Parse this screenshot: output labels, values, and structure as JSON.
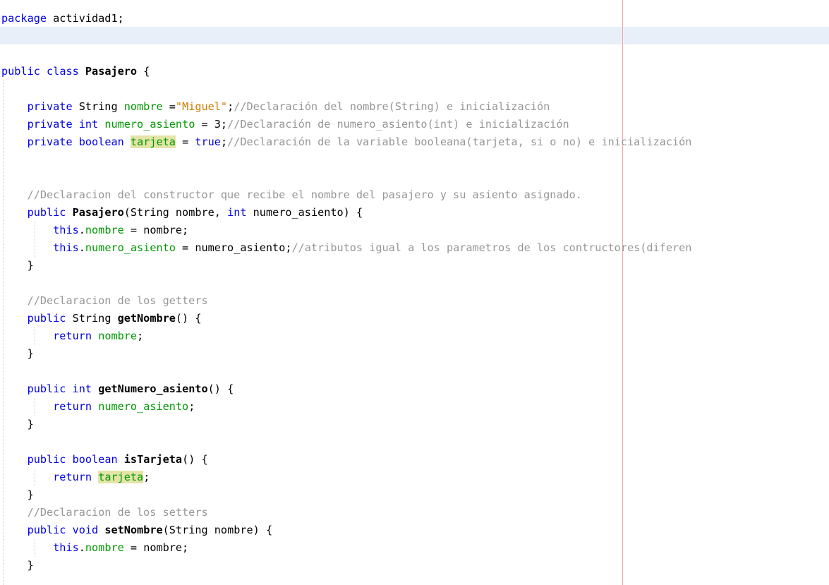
{
  "editor": {
    "name": "java-code-editor",
    "language": "Java",
    "colors": {
      "keyword": "#0000e6",
      "field": "#009900",
      "string": "#ce7b00",
      "comment": "#969696",
      "current_line": "#e9eff8",
      "occurrence_highlight": "#e4e4a8",
      "margin_guide": "#f0a8a8"
    },
    "lines": [
      [
        {
          "t": "package",
          "c": "keyword"
        },
        {
          "t": " actividad1;"
        }
      ],
      [],
      [],
      [
        {
          "t": "public",
          "c": "keyword"
        },
        {
          "t": " "
        },
        {
          "t": "class",
          "c": "keyword"
        },
        {
          "t": " "
        },
        {
          "t": "Pasajero",
          "c": "bold"
        },
        {
          "t": " {"
        }
      ],
      [],
      [
        {
          "t": "    "
        },
        {
          "t": "private",
          "c": "keyword"
        },
        {
          "t": " String "
        },
        {
          "t": "nombre",
          "c": "field"
        },
        {
          "t": " ="
        },
        {
          "t": "\"Miguel\"",
          "c": "string"
        },
        {
          "t": ";"
        },
        {
          "t": "//Declaración del nombre(String) e inicialización",
          "c": "comment"
        }
      ],
      [
        {
          "t": "    "
        },
        {
          "t": "private",
          "c": "keyword"
        },
        {
          "t": " "
        },
        {
          "t": "int",
          "c": "keyword"
        },
        {
          "t": " "
        },
        {
          "t": "numero_asiento",
          "c": "field"
        },
        {
          "t": " = 3;"
        },
        {
          "t": "//Declaración de numero_asiento(int) e inicialización",
          "c": "comment"
        }
      ],
      [
        {
          "t": "    "
        },
        {
          "t": "private",
          "c": "keyword"
        },
        {
          "t": " "
        },
        {
          "t": "boolean",
          "c": "keyword"
        },
        {
          "t": " "
        },
        {
          "t": "tarjeta",
          "c": "field-mark"
        },
        {
          "t": " = "
        },
        {
          "t": "true",
          "c": "keyword"
        },
        {
          "t": ";"
        },
        {
          "t": "//Declaración de la variable booleana(tarjeta, si o no) e inicialización",
          "c": "comment"
        }
      ],
      [],
      [],
      [
        {
          "t": "    "
        },
        {
          "t": "//Declaracion del constructor que recibe el nombre del pasajero y su asiento asignado.",
          "c": "comment"
        }
      ],
      [
        {
          "t": "    "
        },
        {
          "t": "public",
          "c": "keyword"
        },
        {
          "t": " "
        },
        {
          "t": "Pasajero",
          "c": "bold"
        },
        {
          "t": "(String nombre, "
        },
        {
          "t": "int",
          "c": "keyword"
        },
        {
          "t": " numero_asiento) {"
        }
      ],
      [
        {
          "t": "        "
        },
        {
          "t": "this",
          "c": "keyword"
        },
        {
          "t": "."
        },
        {
          "t": "nombre",
          "c": "field"
        },
        {
          "t": " = nombre;"
        }
      ],
      [
        {
          "t": "        "
        },
        {
          "t": "this",
          "c": "keyword"
        },
        {
          "t": "."
        },
        {
          "t": "numero_asiento",
          "c": "field"
        },
        {
          "t": " = numero_asiento;"
        },
        {
          "t": "//atributos igual a los parametros de los contructores(diferen",
          "c": "comment"
        }
      ],
      [
        {
          "t": "    }"
        }
      ],
      [],
      [
        {
          "t": "    "
        },
        {
          "t": "//Declaracion de los getters",
          "c": "comment"
        }
      ],
      [
        {
          "t": "    "
        },
        {
          "t": "public",
          "c": "keyword"
        },
        {
          "t": " String "
        },
        {
          "t": "getNombre",
          "c": "bold"
        },
        {
          "t": "() {"
        }
      ],
      [
        {
          "t": "        "
        },
        {
          "t": "return",
          "c": "keyword"
        },
        {
          "t": " "
        },
        {
          "t": "nombre",
          "c": "field"
        },
        {
          "t": ";"
        }
      ],
      [
        {
          "t": "    }"
        }
      ],
      [],
      [
        {
          "t": "    "
        },
        {
          "t": "public",
          "c": "keyword"
        },
        {
          "t": " "
        },
        {
          "t": "int",
          "c": "keyword"
        },
        {
          "t": " "
        },
        {
          "t": "getNumero_asiento",
          "c": "bold"
        },
        {
          "t": "() {"
        }
      ],
      [
        {
          "t": "        "
        },
        {
          "t": "return",
          "c": "keyword"
        },
        {
          "t": " "
        },
        {
          "t": "numero_asiento",
          "c": "field"
        },
        {
          "t": ";"
        }
      ],
      [
        {
          "t": "    }"
        }
      ],
      [],
      [
        {
          "t": "    "
        },
        {
          "t": "public",
          "c": "keyword"
        },
        {
          "t": " "
        },
        {
          "t": "boolean",
          "c": "keyword"
        },
        {
          "t": " "
        },
        {
          "t": "isTarjeta",
          "c": "bold"
        },
        {
          "t": "() {"
        }
      ],
      [
        {
          "t": "        "
        },
        {
          "t": "return",
          "c": "keyword"
        },
        {
          "t": " "
        },
        {
          "t": "tarjeta",
          "c": "field-mark"
        },
        {
          "t": ";"
        }
      ],
      [
        {
          "t": "    }"
        }
      ],
      [
        {
          "t": "    "
        },
        {
          "t": "//Declaracion de los setters",
          "c": "comment"
        }
      ],
      [
        {
          "t": "    "
        },
        {
          "t": "public",
          "c": "keyword"
        },
        {
          "t": " "
        },
        {
          "t": "void",
          "c": "keyword"
        },
        {
          "t": " "
        },
        {
          "t": "setNombre",
          "c": "bold"
        },
        {
          "t": "(String nombre) {"
        }
      ],
      [
        {
          "t": "        "
        },
        {
          "t": "this",
          "c": "keyword"
        },
        {
          "t": "."
        },
        {
          "t": "nombre",
          "c": "field"
        },
        {
          "t": " = nombre;"
        }
      ],
      [
        {
          "t": "    }"
        }
      ]
    ]
  }
}
